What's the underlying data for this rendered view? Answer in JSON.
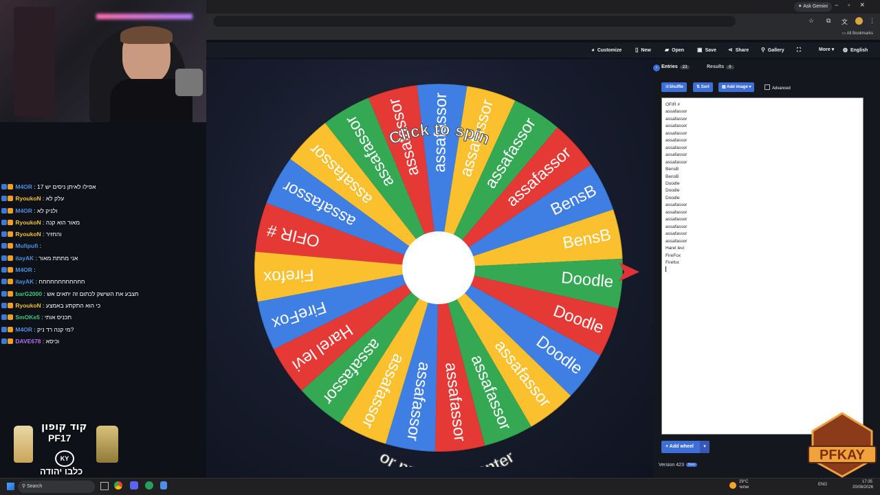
{
  "browser": {
    "ask_gemini": "Ask Gemini",
    "all_bookmarks": "All Bookmarks"
  },
  "toolbar": {
    "customize": "Customize",
    "new": "New",
    "open": "Open",
    "save": "Save",
    "share": "Share",
    "gallery": "Gallery",
    "more": "More",
    "language": "English"
  },
  "wheel": {
    "click_to_spin": "Click to spin",
    "or_press": "or press ctrl+enter",
    "pointer_color": "#e0323a",
    "colors": [
      "#e53935",
      "#3f7fe3",
      "#fbc02d",
      "#34a853"
    ]
  },
  "panel": {
    "entries_tab": "Entries",
    "entries_count": "23",
    "results_tab": "Results",
    "results_count": "0",
    "shuffle": "Shuffle",
    "sort": "Sort",
    "add_image": "Add image",
    "advanced": "Advanced",
    "entries": [
      "OFIR #",
      "assafassor",
      "assafassor",
      "assafassor",
      "assafassor",
      "assafassor",
      "assafassor",
      "assafassor",
      "assafassor",
      "BensB",
      "BensB",
      "Doodle",
      "Doodle",
      "Doodle",
      "assafassor",
      "assafassor",
      "assafassor",
      "assafassor",
      "assafassor",
      "assafassor",
      "Harel levi",
      "FireFox",
      "Firefox"
    ],
    "add_wheel": "Add wheel",
    "version": "Version 423",
    "new_badge": "New"
  },
  "chat": [
    {
      "user": "M4OR",
      "color": "#4a90e2",
      "msg": "אפילו לאיתן ניסים יש 17"
    },
    {
      "user": "RyoukoN",
      "color": "#f0c030",
      "msg": "עלק לא"
    },
    {
      "user": "M4OR",
      "color": "#4a90e2",
      "msg": "ולניק לא"
    },
    {
      "user": "RyoukoN",
      "color": "#f0c030",
      "msg": "מאור הוא קנה"
    },
    {
      "user": "RyoukoN",
      "color": "#f0c030",
      "msg": "והחזיר"
    },
    {
      "user": "Mufipufi",
      "color": "#4a90e2",
      "msg": ""
    },
    {
      "user": "itayAK",
      "color": "#4a90e2",
      "msg": "אני מתתת מאור"
    },
    {
      "user": "M4OR",
      "color": "#4a90e2",
      "msg": ""
    },
    {
      "user": "itayAK",
      "color": "#4a90e2",
      "msg": "חחחחחחחחחחחח"
    },
    {
      "user": "barG2000",
      "color": "#3fc87a",
      "msg": "חצבע את השישק לכתום זה יתאים אש"
    },
    {
      "user": "RyoukoN",
      "color": "#f0c030",
      "msg": "כי הוא התקתע באמצע"
    },
    {
      "user": "SmOKe5",
      "color": "#3fc87a",
      "msg": "תכניס אותי"
    },
    {
      "user": "M4OR",
      "color": "#4a90e2",
      "msg": "מי קנה רד ניק?"
    },
    {
      "user": "DAVE678",
      "color": "#b46cf0",
      "msg": "וכיסא"
    }
  ],
  "promo": {
    "code_line1": "קוד קופון",
    "code_line2": "PF17",
    "logo": "KY",
    "tagline": "כלבו יהודה"
  },
  "taskbar": {
    "search": "Search",
    "weather": "29°C",
    "weather_sub": "שמשי",
    "lang": "ENG",
    "time": "17:35",
    "date": "20/08/2026"
  }
}
